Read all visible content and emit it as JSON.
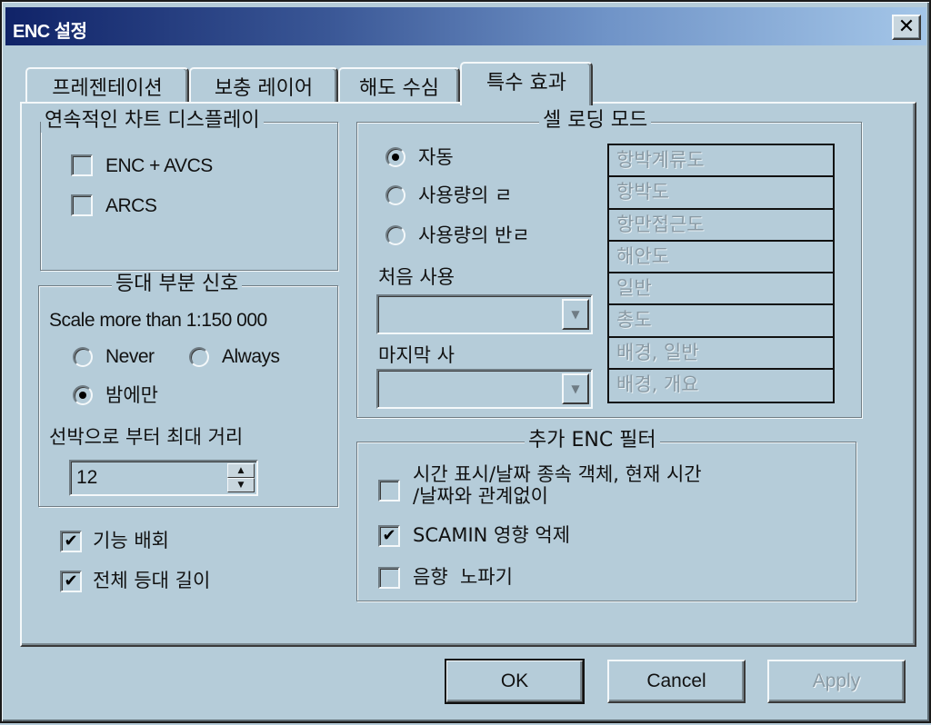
{
  "window": {
    "title": "ENC 설정",
    "close_icon": "close-icon"
  },
  "tabs": [
    {
      "label": "프레젠테이션",
      "active": false
    },
    {
      "label": "보충 레이어",
      "active": false
    },
    {
      "label": "해도 수심",
      "active": false
    },
    {
      "label": "특수 효과",
      "active": true
    }
  ],
  "continuous_display": {
    "legend": "연속적인 차트 디스플레이",
    "options": [
      {
        "label": "ENC + AVCS",
        "checked": false
      },
      {
        "label": "ARCS",
        "checked": false
      }
    ]
  },
  "lighthouse_sector": {
    "legend": "등대 부분 신호",
    "scale_label": "Scale more than 1:150 000",
    "radios": [
      {
        "label": "Never",
        "checked": false
      },
      {
        "label": "Always",
        "checked": false
      },
      {
        "label": "밤에만",
        "checked": true
      }
    ],
    "distance_label": "선박으로 부터 최대 거리",
    "distance_value": "12",
    "spin_up_icon": "arrow-up-icon",
    "spin_down_icon": "arrow-down-icon"
  },
  "bottom_checks": [
    {
      "label": "기능 배회",
      "checked": true
    },
    {
      "label": "전체 등대 길이",
      "checked": true
    }
  ],
  "cell_loading": {
    "legend": "셀 로딩 모드",
    "radios": [
      {
        "label": "자동",
        "checked": true
      },
      {
        "label": "사용량의 ㄹ",
        "checked": false
      },
      {
        "label": "사용량의 반ㄹ",
        "checked": false
      }
    ],
    "first_use_label": "처음 사용",
    "first_use_value": "",
    "last_use_label": "마지막 사",
    "last_use_value": "",
    "chart_types": [
      "항박계류도",
      "항박도",
      "항만접근도",
      "해안도",
      "일반",
      "총도",
      "배경, 일반",
      "배경, 개요"
    ]
  },
  "extra_filters": {
    "legend": "추가 ENC 필터",
    "options": [
      {
        "label_line1": "시간 표시/날짜 종속 객체, 현재 시간",
        "label_line2": "/날짜와 관계없이",
        "checked": false
      },
      {
        "label_line1": "SCAMIN 영향 억제",
        "label_line2": "",
        "checked": true
      },
      {
        "label_line1": "음향  노파기",
        "label_line2": "",
        "checked": false
      }
    ]
  },
  "buttons": {
    "ok": "OK",
    "cancel": "Cancel",
    "apply": "Apply"
  },
  "glyphs": {
    "check": "✔",
    "close": "✕",
    "up": "▲",
    "down": "▼"
  }
}
